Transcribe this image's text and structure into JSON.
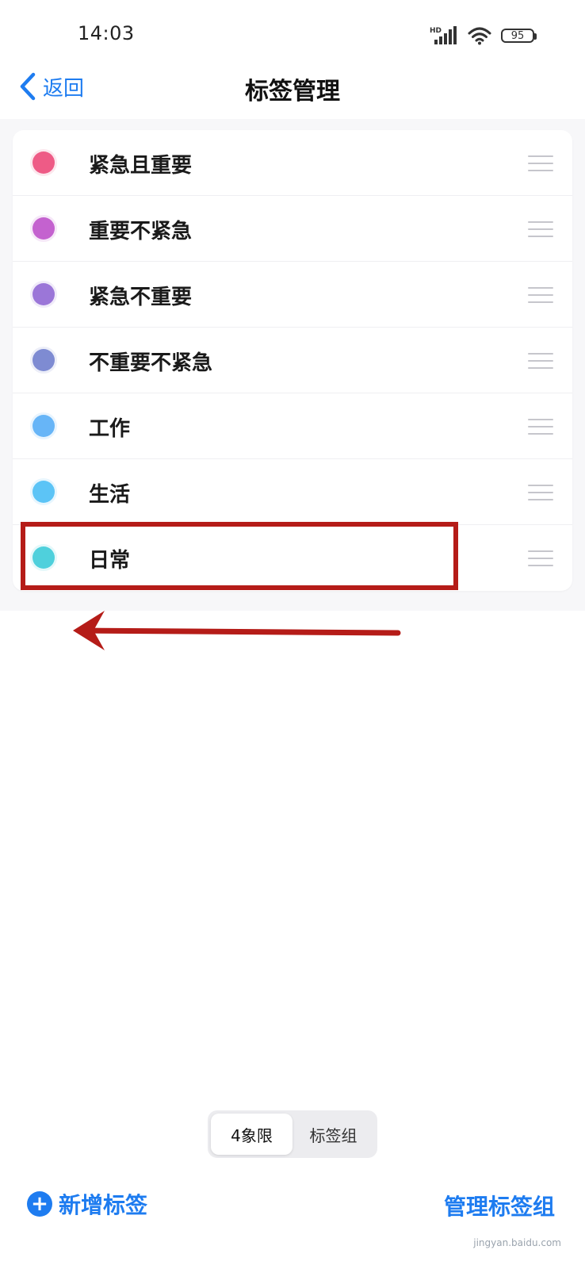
{
  "status_bar": {
    "time": "14:03",
    "network_label": "HD",
    "battery": "95"
  },
  "nav": {
    "back_label": "返回",
    "title": "标签管理"
  },
  "tags": [
    {
      "name": "紧急且重要",
      "color": "#ee5b86"
    },
    {
      "name": "重要不紧急",
      "color": "#c462cf"
    },
    {
      "name": "紧急不重要",
      "color": "#9b76d8"
    },
    {
      "name": "不重要不紧急",
      "color": "#7e8bd2"
    },
    {
      "name": "工作",
      "color": "#67b5f7"
    },
    {
      "name": "生活",
      "color": "#5cc4f6"
    },
    {
      "name": "日常",
      "color": "#4fd0dc"
    }
  ],
  "segment": {
    "options": [
      "4象限",
      "标签组"
    ],
    "selected": "4象限"
  },
  "bottom": {
    "add_label": "新增标签",
    "manage_label": "管理标签组"
  },
  "annotation": {
    "highlight_color": "#b51c18"
  },
  "colors": {
    "accent": "#1e7cf0"
  },
  "watermark": "jingyan.baidu.com"
}
